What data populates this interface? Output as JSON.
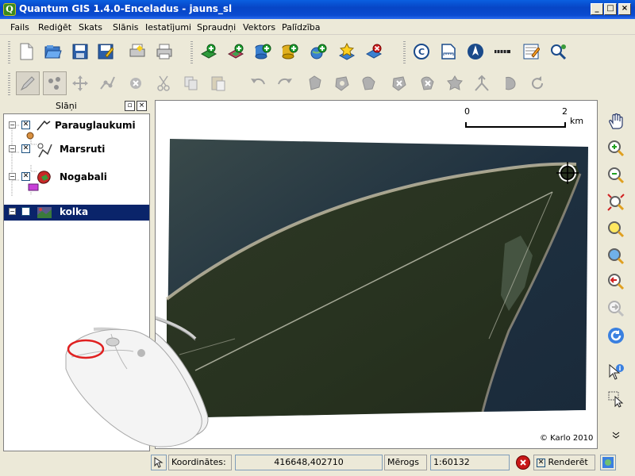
{
  "window": {
    "title": "Quantum GIS 1.4.0-Enceladus - jauns_sl",
    "app_icon": "Q",
    "controls": [
      "_",
      "□",
      "×"
    ]
  },
  "menu": [
    "Fails",
    "Rediģēt",
    "Skats",
    "Slānis",
    "Iestatījumi",
    "Spraudņi",
    "Vektors",
    "Palīdzība"
  ],
  "panel": {
    "title": "Slāņi",
    "float_btn": "▫",
    "close_btn": "×",
    "layers": [
      {
        "name": "Parauglaukumi",
        "checked": "✕",
        "icon": "line-layer-icon"
      },
      {
        "name": "Marsruti",
        "checked": "✕",
        "icon": "point-layer-icon"
      },
      {
        "name": "Nogabali",
        "checked": "✕",
        "icon": "polygon-layer-icon"
      },
      {
        "name": "kolka",
        "checked": "✕",
        "icon": "raster-layer-icon",
        "selected": true
      }
    ]
  },
  "map": {
    "scale_start": "0",
    "scale_end": "2",
    "scale_unit": "km",
    "copyright": "© Karlo 2010"
  },
  "statusbar": {
    "coords_label": "Koordinātes:",
    "coords_value": "416648,402710",
    "scale_label": "Mērogs",
    "scale_value": "1:60132",
    "render_label": "Renderēt"
  },
  "colors": {
    "titlebar": "#0a4bd0",
    "selection": "#0a246a",
    "background": "#ece9d8"
  }
}
